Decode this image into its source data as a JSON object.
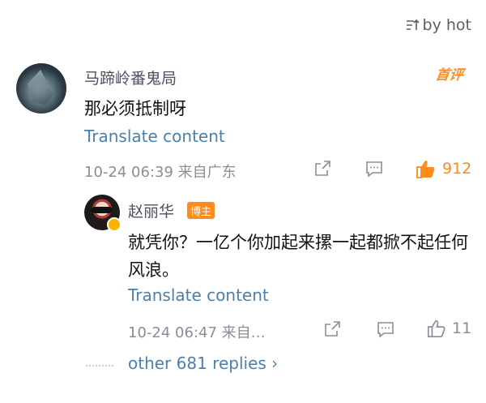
{
  "sort": {
    "label": "by hot"
  },
  "comment": {
    "author": "马蹄岭番鬼局",
    "badge": "首评",
    "text": "那必须抵制呀",
    "translate": "Translate content",
    "meta": "10-24 06:39  来自广东",
    "likes": "912"
  },
  "reply": {
    "author": "赵丽华",
    "badge": "博主",
    "text": "就凭你？一亿个你加起来摞一起都掀不起任何风浪。",
    "translate": "Translate content",
    "meta": "10-24 06:47  来自…",
    "likes": "11"
  },
  "more_replies": "other 681 replies ›",
  "colors": {
    "link": "#4c80aa",
    "accent": "#ff8a1e",
    "muted": "#8a8d96"
  }
}
